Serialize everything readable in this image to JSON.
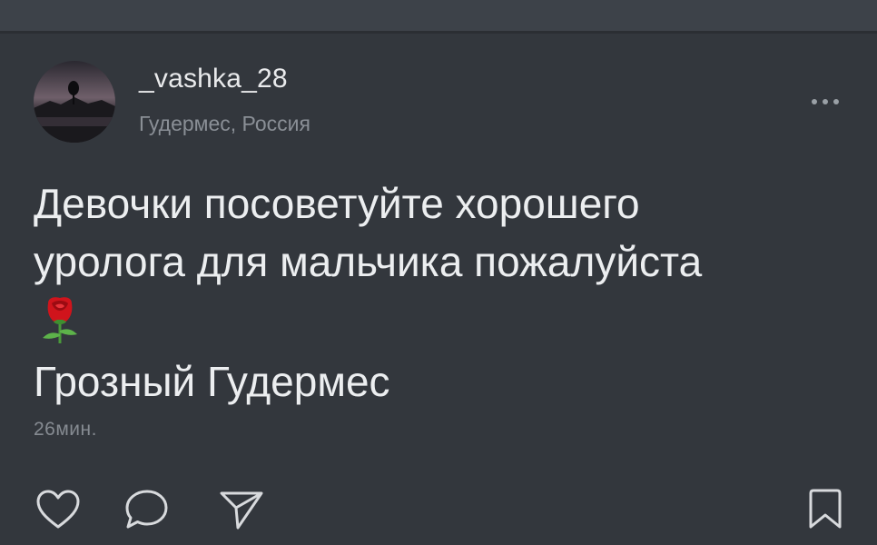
{
  "post": {
    "username": "_vashka_28",
    "location": "Гудермес, Россия",
    "text_lines": [
      "Девочки посоветуйте хорошего",
      "уролога для мальчика пожалуйста"
    ],
    "emoji": "rose-emoji",
    "text_last_line": "Грозный Гудермес",
    "timestamp": "26мин."
  },
  "actions": {
    "like_icon": "heart-icon",
    "comment_icon": "speech-bubble-icon",
    "share_icon": "paper-plane-icon",
    "bookmark_icon": "bookmark-icon",
    "more_icon": "ellipsis-icon"
  },
  "colors": {
    "background": "#33373d",
    "topbar": "#3d4249",
    "text_primary": "#eceef0",
    "text_secondary": "#8a8f96",
    "icon": "#d8dadd"
  }
}
